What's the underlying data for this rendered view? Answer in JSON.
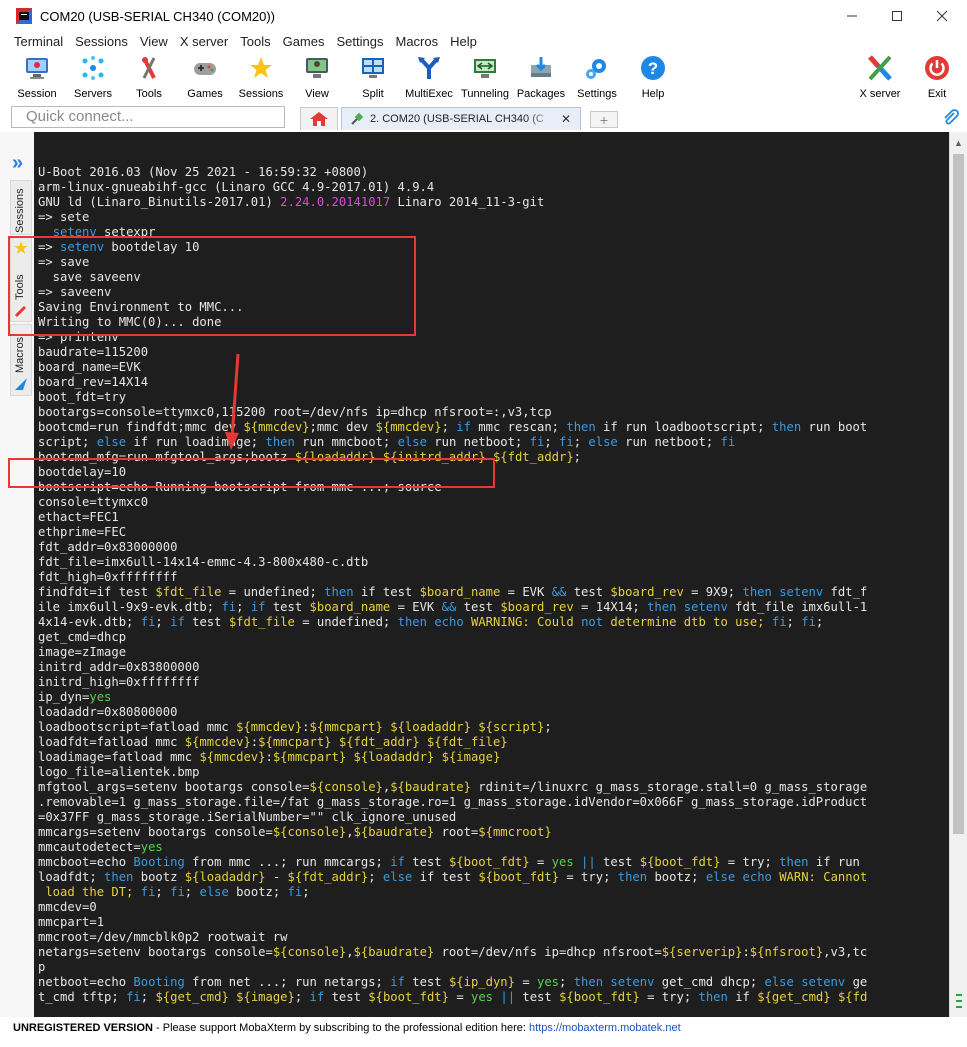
{
  "window": {
    "title": "COM20  (USB-SERIAL CH340 (COM20))"
  },
  "menu": [
    "Terminal",
    "Sessions",
    "View",
    "X server",
    "Tools",
    "Games",
    "Settings",
    "Macros",
    "Help"
  ],
  "toolbar": {
    "session": "Session",
    "servers": "Servers",
    "tools": "Tools",
    "games": "Games",
    "sessions": "Sessions",
    "view": "View",
    "split": "Split",
    "multiexec": "MultiExec",
    "tunneling": "Tunneling",
    "packages": "Packages",
    "settings": "Settings",
    "help": "Help",
    "xserver": "X server",
    "exit": "Exit"
  },
  "quick_connect": {
    "placeholder": "Quick connect..."
  },
  "tabs": {
    "active_label": "2. COM20  (USB-SERIAL CH340 (C",
    "close": "✕",
    "new_tab": "+"
  },
  "side_panel": {
    "sessions": "Sessions",
    "tools": "Tools",
    "macros": "Macros"
  },
  "colors": {
    "terminal_bg": "#1e1e1e",
    "annotation": "#e53935",
    "accent": "#2a7de1"
  },
  "terminal_lines": [
    [
      {
        "t": "U-Boot 2016.03 (Nov 25 2021 - 16:59:32 +0800)",
        "c": ""
      }
    ],
    [
      {
        "t": "arm-linux-gnueabihf-gcc (Linaro GCC 4.9-2017.01) 4.9.4",
        "c": ""
      }
    ],
    [
      {
        "t": "GNU ld (Linaro_Binutils-2017.01) ",
        "c": ""
      },
      {
        "t": "2.24.0.20141017",
        "c": "m"
      },
      {
        "t": " Linaro 2014_11-3-git",
        "c": ""
      }
    ],
    [
      {
        "t": "=> sete",
        "c": ""
      }
    ],
    [
      {
        "t": "  ",
        "c": ""
      },
      {
        "t": "setenv",
        "c": "c"
      },
      {
        "t": " setexpr",
        "c": ""
      }
    ],
    [
      {
        "t": "=> ",
        "c": ""
      },
      {
        "t": "setenv",
        "c": "c"
      },
      {
        "t": " bootdelay 10",
        "c": ""
      }
    ],
    [
      {
        "t": "=> save",
        "c": ""
      }
    ],
    [
      {
        "t": "  save saveenv",
        "c": ""
      }
    ],
    [
      {
        "t": "=> saveenv",
        "c": ""
      }
    ],
    [
      {
        "t": "Saving Environment to MMC...",
        "c": ""
      }
    ],
    [
      {
        "t": "Writing to MMC(0)... done",
        "c": ""
      }
    ],
    [
      {
        "t": "=> printenv",
        "c": ""
      }
    ],
    [
      {
        "t": "baudrate=115200",
        "c": ""
      }
    ],
    [
      {
        "t": "board_name=EVK",
        "c": ""
      }
    ],
    [
      {
        "t": "board_rev=14X14",
        "c": ""
      }
    ],
    [
      {
        "t": "boot_fdt=try",
        "c": ""
      }
    ],
    [
      {
        "t": "bootargs=console=ttymxc0,115200 root=/dev/nfs ip=dhcp nfsroot=:,v3,tcp",
        "c": ""
      }
    ],
    [
      {
        "t": "bootcmd=run findfdt;mmc dev ",
        "c": ""
      },
      {
        "t": "${mmcdev}",
        "c": "y"
      },
      {
        "t": ";mmc dev ",
        "c": ""
      },
      {
        "t": "${mmcdev}",
        "c": "y"
      },
      {
        "t": "; ",
        "c": ""
      },
      {
        "t": "if",
        "c": "c"
      },
      {
        "t": " mmc rescan; ",
        "c": ""
      },
      {
        "t": "then",
        "c": "c"
      },
      {
        "t": " if run loadbootscript; ",
        "c": ""
      },
      {
        "t": "then",
        "c": "c"
      },
      {
        "t": " run boot",
        "c": ""
      }
    ],
    [
      {
        "t": "script; ",
        "c": ""
      },
      {
        "t": "else",
        "c": "c"
      },
      {
        "t": " if run loadimage; ",
        "c": ""
      },
      {
        "t": "then",
        "c": "c"
      },
      {
        "t": " run mmcboot; ",
        "c": ""
      },
      {
        "t": "else",
        "c": "c"
      },
      {
        "t": " run netboot; ",
        "c": ""
      },
      {
        "t": "fi",
        "c": "c"
      },
      {
        "t": "; ",
        "c": ""
      },
      {
        "t": "fi",
        "c": "c"
      },
      {
        "t": "; ",
        "c": ""
      },
      {
        "t": "else",
        "c": "c"
      },
      {
        "t": " run netboot; ",
        "c": ""
      },
      {
        "t": "fi",
        "c": "c"
      }
    ],
    [
      {
        "t": "bootcmd_mfg=run mfgtool_args;bootz ",
        "c": ""
      },
      {
        "t": "${loadaddr}",
        "c": "y"
      },
      {
        "t": " ",
        "c": ""
      },
      {
        "t": "${initrd_addr}",
        "c": "y"
      },
      {
        "t": " ",
        "c": ""
      },
      {
        "t": "${fdt_addr}",
        "c": "y"
      },
      {
        "t": ";",
        "c": ""
      }
    ],
    [
      {
        "t": "bootdelay=10",
        "c": ""
      }
    ],
    [
      {
        "t": "bootscript=echo Running bootscript from mmc ...; source",
        "c": ""
      }
    ],
    [
      {
        "t": "console=ttymxc0",
        "c": ""
      }
    ],
    [
      {
        "t": "ethact=FEC1",
        "c": ""
      }
    ],
    [
      {
        "t": "ethprime=FEC",
        "c": ""
      }
    ],
    [
      {
        "t": "fdt_addr=0x83000000",
        "c": ""
      }
    ],
    [
      {
        "t": "fdt_file=imx6ull-14x14-emmc-4.3-800x480-c.dtb",
        "c": ""
      }
    ],
    [
      {
        "t": "fdt_high=0xffffffff",
        "c": ""
      }
    ],
    [
      {
        "t": "findfdt=if test ",
        "c": ""
      },
      {
        "t": "$fdt_file",
        "c": "y"
      },
      {
        "t": " = undefined; ",
        "c": ""
      },
      {
        "t": "then",
        "c": "c"
      },
      {
        "t": " if test ",
        "c": ""
      },
      {
        "t": "$board_name",
        "c": "y"
      },
      {
        "t": " = EVK ",
        "c": ""
      },
      {
        "t": "&&",
        "c": "c"
      },
      {
        "t": " test ",
        "c": ""
      },
      {
        "t": "$board_rev",
        "c": "y"
      },
      {
        "t": " = 9X9; ",
        "c": ""
      },
      {
        "t": "then",
        "c": "c"
      },
      {
        "t": " ",
        "c": ""
      },
      {
        "t": "setenv",
        "c": "c"
      },
      {
        "t": " fdt_f",
        "c": ""
      }
    ],
    [
      {
        "t": "ile imx6ull-9x9-evk.dtb; ",
        "c": ""
      },
      {
        "t": "fi",
        "c": "c"
      },
      {
        "t": "; ",
        "c": ""
      },
      {
        "t": "if",
        "c": "c"
      },
      {
        "t": " test ",
        "c": ""
      },
      {
        "t": "$board_name",
        "c": "y"
      },
      {
        "t": " = EVK ",
        "c": ""
      },
      {
        "t": "&&",
        "c": "c"
      },
      {
        "t": " test ",
        "c": ""
      },
      {
        "t": "$board_rev",
        "c": "y"
      },
      {
        "t": " = 14X14; ",
        "c": ""
      },
      {
        "t": "then",
        "c": "c"
      },
      {
        "t": " ",
        "c": ""
      },
      {
        "t": "setenv",
        "c": "c"
      },
      {
        "t": " fdt_file imx6ull-1",
        "c": ""
      }
    ],
    [
      {
        "t": "4x14-evk.dtb; ",
        "c": ""
      },
      {
        "t": "fi",
        "c": "c"
      },
      {
        "t": "; ",
        "c": ""
      },
      {
        "t": "if",
        "c": "c"
      },
      {
        "t": " test ",
        "c": ""
      },
      {
        "t": "$fdt_file",
        "c": "y"
      },
      {
        "t": " = undefined; ",
        "c": ""
      },
      {
        "t": "then",
        "c": "c"
      },
      {
        "t": " ",
        "c": ""
      },
      {
        "t": "echo",
        "c": "c"
      },
      {
        "t": " WARNING: Could ",
        "c": "y"
      },
      {
        "t": "not",
        "c": "c"
      },
      {
        "t": " determine dtb to use; ",
        "c": "y"
      },
      {
        "t": "fi",
        "c": "c"
      },
      {
        "t": "; ",
        "c": ""
      },
      {
        "t": "fi",
        "c": "c"
      },
      {
        "t": ";",
        "c": ""
      }
    ],
    [
      {
        "t": "get_cmd=dhcp",
        "c": ""
      }
    ],
    [
      {
        "t": "image=zImage",
        "c": ""
      }
    ],
    [
      {
        "t": "initrd_addr=0x83800000",
        "c": ""
      }
    ],
    [
      {
        "t": "initrd_high=0xffffffff",
        "c": ""
      }
    ],
    [
      {
        "t": "ip_dyn=",
        "c": ""
      },
      {
        "t": "yes",
        "c": "g"
      }
    ],
    [
      {
        "t": "loadaddr=0x80800000",
        "c": ""
      }
    ],
    [
      {
        "t": "loadbootscript=fatload mmc ",
        "c": ""
      },
      {
        "t": "${mmcdev}",
        "c": "y"
      },
      {
        "t": ":",
        "c": ""
      },
      {
        "t": "${mmcpart}",
        "c": "y"
      },
      {
        "t": " ",
        "c": ""
      },
      {
        "t": "${loadaddr}",
        "c": "y"
      },
      {
        "t": " ",
        "c": ""
      },
      {
        "t": "${script}",
        "c": "y"
      },
      {
        "t": ";",
        "c": ""
      }
    ],
    [
      {
        "t": "loadfdt=fatload mmc ",
        "c": ""
      },
      {
        "t": "${mmcdev}",
        "c": "y"
      },
      {
        "t": ":",
        "c": ""
      },
      {
        "t": "${mmcpart}",
        "c": "y"
      },
      {
        "t": " ",
        "c": ""
      },
      {
        "t": "${fdt_addr}",
        "c": "y"
      },
      {
        "t": " ",
        "c": ""
      },
      {
        "t": "${fdt_file}",
        "c": "y"
      }
    ],
    [
      {
        "t": "loadimage=fatload mmc ",
        "c": ""
      },
      {
        "t": "${mmcdev}",
        "c": "y"
      },
      {
        "t": ":",
        "c": ""
      },
      {
        "t": "${mmcpart}",
        "c": "y"
      },
      {
        "t": " ",
        "c": ""
      },
      {
        "t": "${loadaddr}",
        "c": "y"
      },
      {
        "t": " ",
        "c": ""
      },
      {
        "t": "${image}",
        "c": "y"
      }
    ],
    [
      {
        "t": "logo_file=alientek.bmp",
        "c": ""
      }
    ],
    [
      {
        "t": "mfgtool_args=setenv bootargs console=",
        "c": ""
      },
      {
        "t": "${console}",
        "c": "y"
      },
      {
        "t": ",",
        "c": ""
      },
      {
        "t": "${baudrate}",
        "c": "y"
      },
      {
        "t": " rdinit=/linuxrc g_mass_storage.stall=0 g_mass_storage",
        "c": ""
      }
    ],
    [
      {
        "t": ".removable=1 g_mass_storage.file=/fat g_mass_storage.ro=1 g_mass_storage.idVendor=0x066F g_mass_storage.idProduct",
        "c": ""
      }
    ],
    [
      {
        "t": "=0x37FF g_mass_storage.iSerialNumber=\"\" clk_ignore_unused",
        "c": ""
      }
    ],
    [
      {
        "t": "mmcargs=setenv bootargs console=",
        "c": ""
      },
      {
        "t": "${console}",
        "c": "y"
      },
      {
        "t": ",",
        "c": ""
      },
      {
        "t": "${baudrate}",
        "c": "y"
      },
      {
        "t": " root=",
        "c": ""
      },
      {
        "t": "${mmcroot}",
        "c": "y"
      }
    ],
    [
      {
        "t": "mmcautodetect=",
        "c": ""
      },
      {
        "t": "yes",
        "c": "g"
      }
    ],
    [
      {
        "t": "mmcboot=echo ",
        "c": ""
      },
      {
        "t": "Booting",
        "c": "c"
      },
      {
        "t": " from mmc ...; run mmcargs; ",
        "c": ""
      },
      {
        "t": "if",
        "c": "c"
      },
      {
        "t": " test ",
        "c": ""
      },
      {
        "t": "${boot_fdt}",
        "c": "y"
      },
      {
        "t": " = ",
        "c": ""
      },
      {
        "t": "yes",
        "c": "g"
      },
      {
        "t": " ",
        "c": ""
      },
      {
        "t": "||",
        "c": "c"
      },
      {
        "t": " test ",
        "c": ""
      },
      {
        "t": "${boot_fdt}",
        "c": "y"
      },
      {
        "t": " = try; ",
        "c": ""
      },
      {
        "t": "then",
        "c": "c"
      },
      {
        "t": " if run",
        "c": ""
      }
    ],
    [
      {
        "t": "loadfdt; ",
        "c": ""
      },
      {
        "t": "then",
        "c": "c"
      },
      {
        "t": " bootz ",
        "c": ""
      },
      {
        "t": "${loadaddr}",
        "c": "y"
      },
      {
        "t": " - ",
        "c": ""
      },
      {
        "t": "${fdt_addr}",
        "c": "y"
      },
      {
        "t": "; ",
        "c": ""
      },
      {
        "t": "else",
        "c": "c"
      },
      {
        "t": " if test ",
        "c": ""
      },
      {
        "t": "${boot_fdt}",
        "c": "y"
      },
      {
        "t": " = try; ",
        "c": ""
      },
      {
        "t": "then",
        "c": "c"
      },
      {
        "t": " bootz; ",
        "c": ""
      },
      {
        "t": "else",
        "c": "c"
      },
      {
        "t": " ",
        "c": ""
      },
      {
        "t": "echo",
        "c": "c"
      },
      {
        "t": " WARN: Cannot",
        "c": "y"
      }
    ],
    [
      {
        "t": " load the DT; ",
        "c": "y"
      },
      {
        "t": "fi",
        "c": "c"
      },
      {
        "t": "; ",
        "c": ""
      },
      {
        "t": "fi",
        "c": "c"
      },
      {
        "t": "; ",
        "c": ""
      },
      {
        "t": "else",
        "c": "c"
      },
      {
        "t": " bootz; ",
        "c": ""
      },
      {
        "t": "fi",
        "c": "c"
      },
      {
        "t": ";",
        "c": ""
      }
    ],
    [
      {
        "t": "mmcdev=0",
        "c": ""
      }
    ],
    [
      {
        "t": "mmcpart=1",
        "c": ""
      }
    ],
    [
      {
        "t": "mmcroot=/dev/mmcblk0p2 rootwait rw",
        "c": ""
      }
    ],
    [
      {
        "t": "netargs=setenv bootargs console=",
        "c": ""
      },
      {
        "t": "${console}",
        "c": "y"
      },
      {
        "t": ",",
        "c": ""
      },
      {
        "t": "${baudrate}",
        "c": "y"
      },
      {
        "t": " root=/dev/nfs ip=dhcp nfsroot=",
        "c": ""
      },
      {
        "t": "${serverip}",
        "c": "y"
      },
      {
        "t": ":",
        "c": ""
      },
      {
        "t": "${nfsroot}",
        "c": "y"
      },
      {
        "t": ",v3,tc",
        "c": ""
      }
    ],
    [
      {
        "t": "p",
        "c": ""
      }
    ],
    [
      {
        "t": "netboot=echo ",
        "c": ""
      },
      {
        "t": "Booting",
        "c": "c"
      },
      {
        "t": " from net ...; run netargs; ",
        "c": ""
      },
      {
        "t": "if",
        "c": "c"
      },
      {
        "t": " test ",
        "c": ""
      },
      {
        "t": "${ip_dyn}",
        "c": "y"
      },
      {
        "t": " = ",
        "c": ""
      },
      {
        "t": "yes",
        "c": "g"
      },
      {
        "t": "; ",
        "c": ""
      },
      {
        "t": "then",
        "c": "c"
      },
      {
        "t": " ",
        "c": ""
      },
      {
        "t": "setenv",
        "c": "c"
      },
      {
        "t": " get_cmd dhcp; ",
        "c": ""
      },
      {
        "t": "else",
        "c": "c"
      },
      {
        "t": " ",
        "c": ""
      },
      {
        "t": "setenv",
        "c": "c"
      },
      {
        "t": " ge",
        "c": ""
      }
    ],
    [
      {
        "t": "t_cmd tftp; ",
        "c": ""
      },
      {
        "t": "fi",
        "c": "c"
      },
      {
        "t": "; ",
        "c": ""
      },
      {
        "t": "${get_cmd}",
        "c": "y"
      },
      {
        "t": " ",
        "c": ""
      },
      {
        "t": "${image}",
        "c": "y"
      },
      {
        "t": "; ",
        "c": ""
      },
      {
        "t": "if",
        "c": "c"
      },
      {
        "t": " test ",
        "c": ""
      },
      {
        "t": "${boot_fdt}",
        "c": "y"
      },
      {
        "t": " = ",
        "c": ""
      },
      {
        "t": "yes",
        "c": "g"
      },
      {
        "t": " ",
        "c": ""
      },
      {
        "t": "||",
        "c": "c"
      },
      {
        "t": " test ",
        "c": ""
      },
      {
        "t": "${boot_fdt}",
        "c": "y"
      },
      {
        "t": " = try; ",
        "c": ""
      },
      {
        "t": "then",
        "c": "c"
      },
      {
        "t": " if ",
        "c": ""
      },
      {
        "t": "${get_cmd}",
        "c": "y"
      },
      {
        "t": " ",
        "c": ""
      },
      {
        "t": "${fd",
        "c": "y"
      }
    ]
  ],
  "status": {
    "unregistered": "UNREGISTERED VERSION",
    "message": "  -  Please support MobaXterm by subscribing to the professional edition here:  ",
    "link": "https://mobaxterm.mobatek.net"
  }
}
